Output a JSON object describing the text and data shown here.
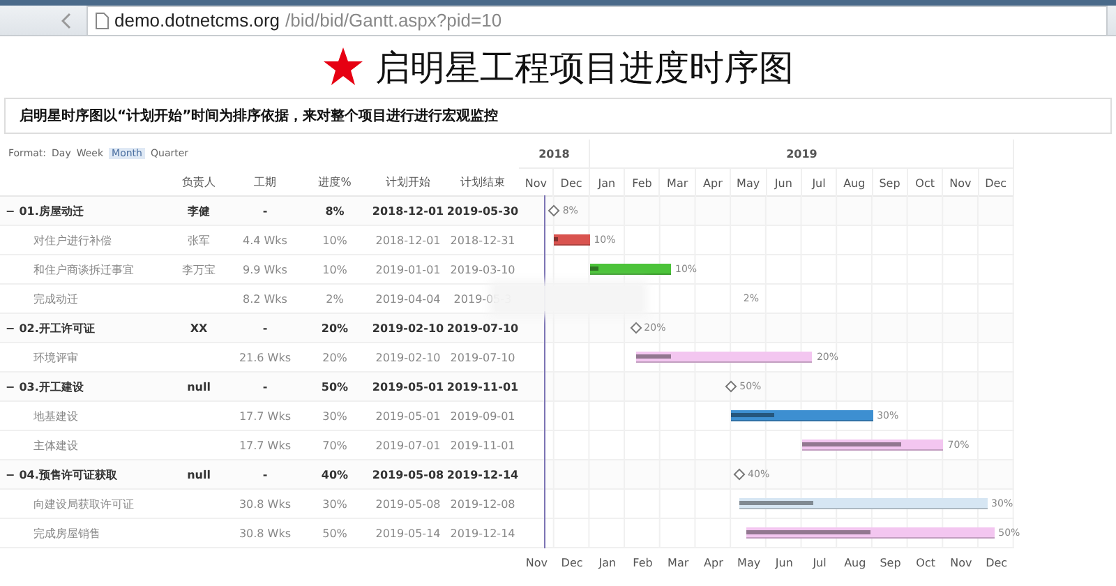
{
  "browser": {
    "url_host": "demo.dotnetcms.org",
    "url_path": "/bid/bid/Gantt.aspx?pid=10"
  },
  "title": "启明星工程项目进度时序图",
  "description": "启明星时序图以“计划开始”时间为排序依据，来对整个项目进行进行宏观监控",
  "format": {
    "label": "Format:",
    "options": [
      {
        "label": "Day",
        "selected": false
      },
      {
        "label": "Week",
        "selected": false
      },
      {
        "label": "Month",
        "selected": true
      },
      {
        "label": "Quarter",
        "selected": false
      }
    ]
  },
  "columns": [
    "负责人",
    "工期",
    "进度%",
    "计划开始",
    "计划结束"
  ],
  "timeline": {
    "years": [
      {
        "label": "2018",
        "months": [
          "Nov",
          "Dec"
        ]
      },
      {
        "label": "2019",
        "months": [
          "Jan",
          "Feb",
          "Mar",
          "Apr",
          "May",
          "Jun",
          "Jul",
          "Aug",
          "Sep",
          "Oct",
          "Nov",
          "Dec"
        ]
      }
    ]
  },
  "rows": [
    {
      "kind": "group",
      "toggle": "−",
      "name": "01.房屋动迁",
      "owner": "李健",
      "duration": "-",
      "progress": "8%",
      "start": "2018-12-01",
      "end": "2019-05-30",
      "bar_label": "8%"
    },
    {
      "kind": "task",
      "name": "对住户进行补偿",
      "owner": "张军",
      "duration": "4.4 Wks",
      "progress": "10%",
      "start": "2018-12-01",
      "end": "2018-12-31",
      "level": 0.1,
      "color": "#d9534f",
      "bar_label": "10%"
    },
    {
      "kind": "task",
      "name": "和住户商谈拆迁事宜",
      "owner": "李万宝",
      "duration": "9.9 Wks",
      "progress": "10%",
      "start": "2019-01-01",
      "end": "2019-03-10",
      "level": 0.1,
      "color": "#4cc33a",
      "bar_label": "10%"
    },
    {
      "kind": "hidden",
      "name": "完成动迁",
      "duration": "8.2 Wks",
      "progress": "2%",
      "start": "2019-04-04",
      "end": "2019-05-3",
      "bar_label": "2%"
    },
    {
      "kind": "group",
      "toggle": "−",
      "name": "02.开工许可证",
      "owner": "XX",
      "duration": "-",
      "progress": "20%",
      "start": "2019-02-10",
      "end": "2019-07-10",
      "bar_label": "20%"
    },
    {
      "kind": "task",
      "name": "环境评审",
      "duration": "21.6 Wks",
      "progress": "20%",
      "start": "2019-02-10",
      "end": "2019-07-10",
      "level": 0.2,
      "color": "#f3c6f0",
      "bar_label": "20%"
    },
    {
      "kind": "group",
      "toggle": "−",
      "name": "03.开工建设",
      "owner": "null",
      "duration": "-",
      "progress": "50%",
      "start": "2019-05-01",
      "end": "2019-11-01",
      "bar_label": "50%"
    },
    {
      "kind": "task",
      "name": "地基建设",
      "duration": "17.7 Wks",
      "progress": "30%",
      "start": "2019-05-01",
      "end": "2019-09-01",
      "level": 0.3,
      "color": "#3d8fd1",
      "bar_label": "30%"
    },
    {
      "kind": "task",
      "name": "主体建设",
      "duration": "17.7 Wks",
      "progress": "70%",
      "start": "2019-07-01",
      "end": "2019-11-01",
      "level": 0.7,
      "color": "#f3c6f0",
      "bar_label": "70%"
    },
    {
      "kind": "group",
      "toggle": "−",
      "name": "04.预售许可证获取",
      "owner": "null",
      "duration": "-",
      "progress": "40%",
      "start": "2019-05-08",
      "end": "2019-12-14",
      "bar_label": "40%"
    },
    {
      "kind": "task",
      "name": "向建设局获取许可证",
      "duration": "30.8 Wks",
      "progress": "30%",
      "start": "2019-05-08",
      "end": "2019-12-08",
      "level": 0.3,
      "color": "#d6e6f3",
      "bar_label": "30%"
    },
    {
      "kind": "task",
      "name": "完成房屋销售",
      "duration": "30.8 Wks",
      "progress": "50%",
      "start": "2019-05-14",
      "end": "2019-12-14",
      "level": 0.5,
      "color": "#f3c6f0",
      "bar_label": "50%"
    }
  ],
  "bottom_months": [
    "Nov",
    "Dec",
    "Jan",
    "Feb",
    "Mar",
    "Apr",
    "May",
    "Jun",
    "Jul",
    "Aug",
    "Sep",
    "Oct",
    "Nov",
    "Dec"
  ]
}
